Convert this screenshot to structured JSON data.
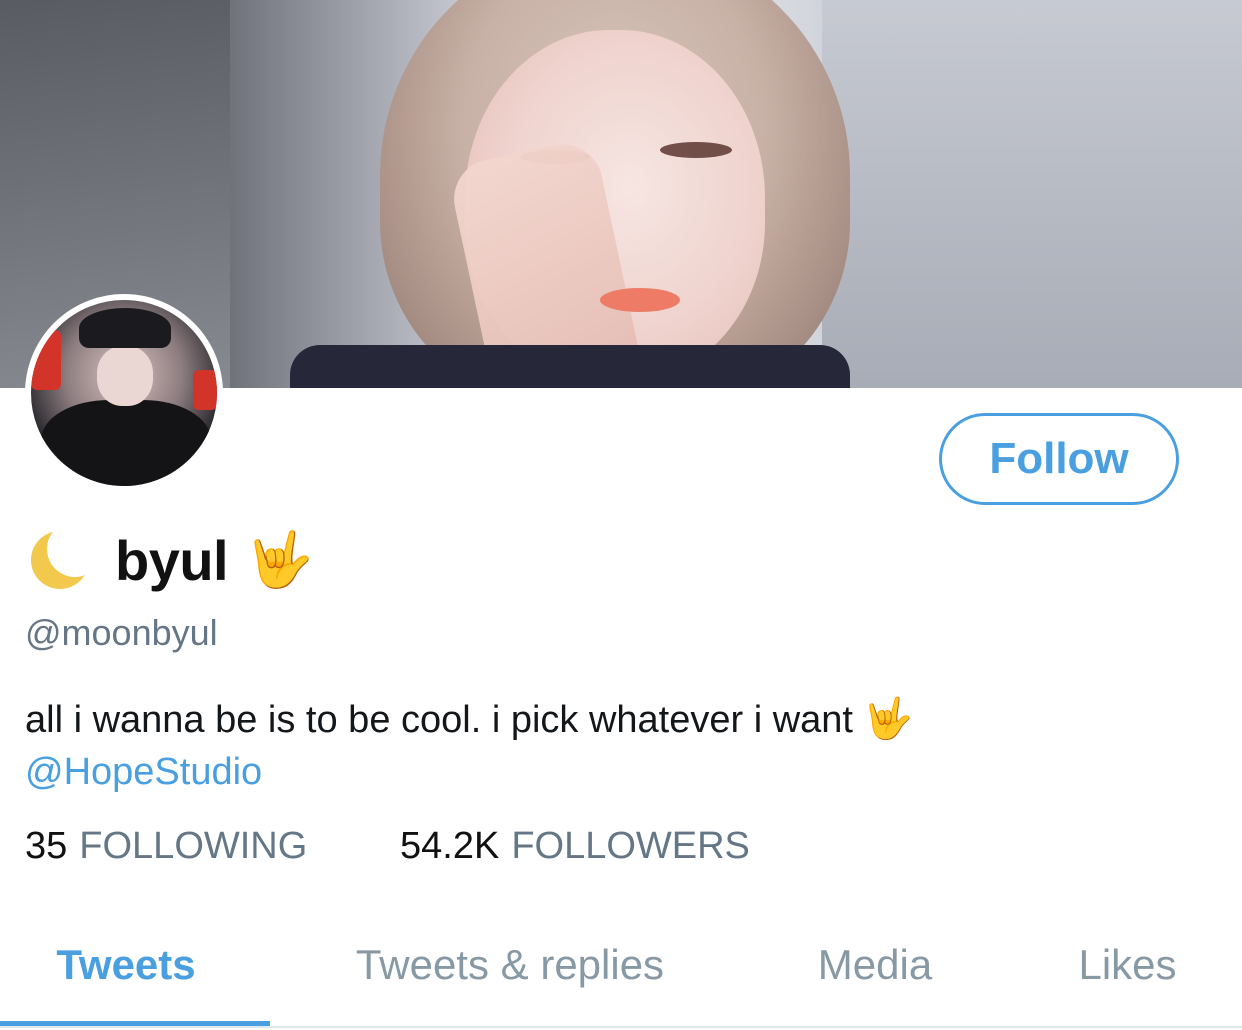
{
  "profile": {
    "display_name": "byul",
    "handle": "@moonbyul",
    "follow_label": "Follow",
    "bio_text": "all i wanna be is to be cool. i pick whatever i want",
    "bio_mention": "@HopeStudio",
    "name_prefix_icon": "crescent-moon-icon",
    "name_suffix_icon": "sign-of-horns-icon",
    "horns_glyph": "🤟",
    "stats": {
      "following_count": "35",
      "following_label": "FOLLOWING",
      "followers_count": "54.2K",
      "followers_label": "FOLLOWERS"
    }
  },
  "tabs": [
    {
      "label": "Tweets",
      "active": true
    },
    {
      "label": "Tweets & replies",
      "active": false
    },
    {
      "label": "Media",
      "active": false
    },
    {
      "label": "Likes",
      "active": false
    }
  ],
  "colors": {
    "accent": "#4a9fe0",
    "muted": "#657786",
    "tab_inactive": "#8899a6"
  }
}
